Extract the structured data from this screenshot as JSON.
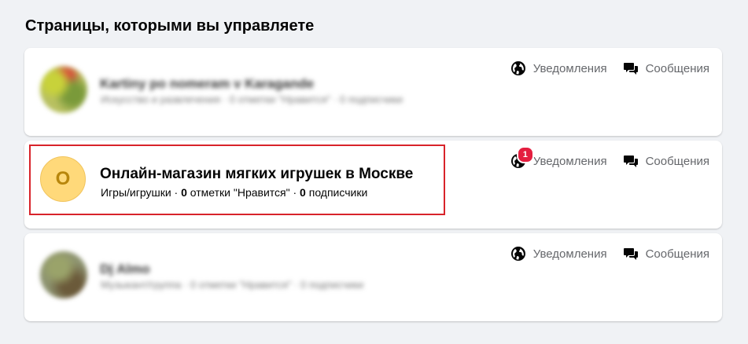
{
  "heading": "Страницы, которыми вы управляете",
  "actions": {
    "notifications_label": "Уведомления",
    "messages_label": "Сообщения"
  },
  "pages": [
    {
      "name": "Kartiny po nomeram v Karagande",
      "meta": "Искусство и развлечения · 0 отметки \"Нравится\" · 0 подписчики",
      "blurred": true,
      "notification_count": null
    },
    {
      "name": "Онлайн-магазин мягких игрушек в Москве",
      "avatar_letter": "О",
      "category": "Игры/игрушки",
      "likes_count": "0",
      "likes_label": "отметки \"Нравится\"",
      "followers_count": "0",
      "followers_label": "подписчики",
      "separator": " · ",
      "blurred": false,
      "notification_count": "1"
    },
    {
      "name": "Dj Almo",
      "meta": "Музыкант/группа · 0 отметки \"Нравится\" · 0 подписчики",
      "blurred": true,
      "notification_count": null
    }
  ],
  "colors": {
    "background": "#f0f2f5",
    "badge": "#e41e3f",
    "highlight": "#d8232a",
    "avatar_fill": "#ffd97a",
    "avatar_letter": "#b8860b"
  },
  "icons": {
    "notifications": "globe-icon",
    "messages": "speech-bubbles-icon"
  }
}
